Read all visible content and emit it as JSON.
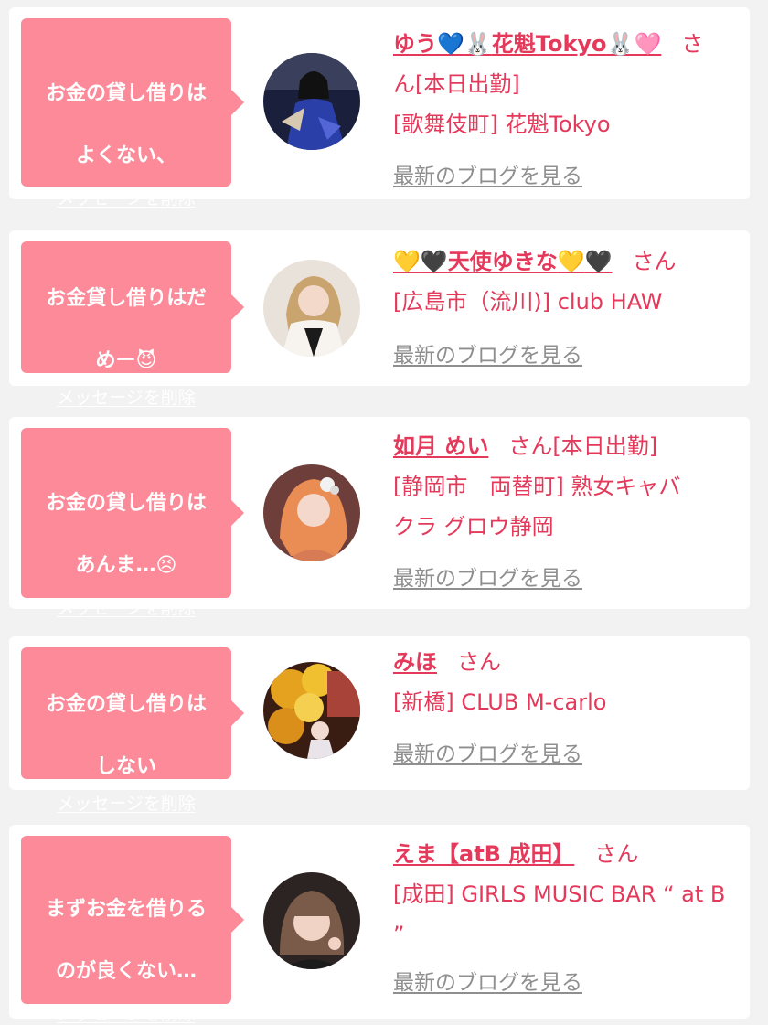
{
  "items": [
    {
      "message_line1": "お金の貸し借りは",
      "message_line2": "よくない、",
      "delete_label": "メッセージを削除",
      "name": "ゆう💙🐰花魁Tokyo🐰🩷",
      "name_parts": [
        "ゆう",
        "💙",
        "🐰",
        "花魁Tokyo",
        "🐰",
        "🩷"
      ],
      "honorific": "さ",
      "line2": "ん[本日出勤]",
      "shop": "[歌舞伎町] 花魁Tokyo",
      "blog_label": "最新のブログを見る"
    },
    {
      "message_line1": "お金貸し借りはだ",
      "message_line2": "めー",
      "message_emoji": "😈",
      "delete_label": "メッセージを削除",
      "name_parts": [
        "💛",
        "🖤",
        "天使ゆきな",
        "💛",
        "🖤"
      ],
      "honorific": "さん",
      "shop": "[広島市（流川)] club HAW",
      "blog_label": "最新のブログを見る"
    },
    {
      "message_line1": "お金の貸し借りは",
      "message_line2": "あんま…",
      "message_emoji": "😣",
      "delete_label": "メッセージを削除",
      "name": "如月 めい",
      "honorific": "さん[本日出勤]",
      "shop_line1": "[静岡市　両替町] 熟女キャバ",
      "shop_line2": "クラ グロウ静岡",
      "blog_label": "最新のブログを見る"
    },
    {
      "message_line1": "お金の貸し借りは",
      "message_line2": "しない",
      "delete_label": "メッセージを削除",
      "name": "みほ",
      "honorific": "さん",
      "shop": "[新橋] CLUB M-carlo",
      "blog_label": "最新のブログを見る"
    },
    {
      "message_line1": "まずお金を借りる",
      "message_line2": "のが良くない…",
      "delete_label": "メッセージを削除",
      "name": "えま【atB 成田】",
      "honorific": "さん",
      "shop_line1": "[成田] GIRLS MUSIC BAR “ at B",
      "shop_line2": "”",
      "blog_label": "最新のブログを見る"
    }
  ],
  "icons": {
    "heart_blue": "💙",
    "heart_pink": "🩷",
    "heart_yellow": "💛",
    "heart_black": "🖤",
    "rabbit": "🐰",
    "devil": "😈",
    "confounded": "😣"
  },
  "colors": {
    "background": "#f2f2f2",
    "card": "#ffffff",
    "bubble": "#fc8a98",
    "name_text": "#e4395a",
    "blog_link": "#8f8f8f"
  }
}
